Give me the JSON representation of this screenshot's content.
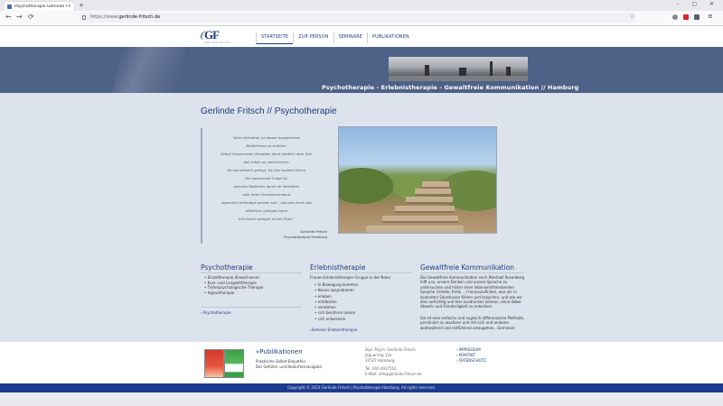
{
  "browser": {
    "tab_title": "Psychotherapie Gerlinde Fritsch",
    "tab_close": "×",
    "new_tab": "+",
    "url_scheme": "https://www.",
    "url_host": "gerlinde-fritsch.de",
    "back": "←",
    "forward": "→",
    "reload": "⟳"
  },
  "header": {
    "logo_text": "GF",
    "logo_sub": "GERLINDE FRITSCH",
    "nav": [
      "STARTSEITE",
      "ZUR PERSON",
      "SEMINARE",
      "PUBLIKATIONEN"
    ]
  },
  "banner": {
    "tagline": "Psychotherapie - Erlebnistherapie - Gewaltfreie Kommunikation // Hamburg"
  },
  "main": {
    "title": "Gerlinde Fritsch // Psychotherapie",
    "quote_lines": [
      "\"Alles Verhalten ist darauf ausgerichtet,",
      "Bedürfnisse zu erfüllen.",
      "Selbst tragischstes Verhalten dient letztlich dem Ziel,",
      "das Leben zu verschönern.",
      "Ob das wirklich gelingt, ist eine andere Sache.",
      "Die spannende Frage ist,",
      "welches Bedürfnis durch Ihr Verhalten",
      "oder Ihren Verhaltensimpuls",
      "eigentlich befriedigt werden soll – und wie Ihnen das",
      "effektiver gelingen kann",
      "mit einem weniger hohen Preis.\""
    ],
    "quote_author": "Gerlinde Fritsch",
    "quote_role": "Psychotherapie Hamburg"
  },
  "columns": {
    "psychotherapie": {
      "title": "Psychotherapie",
      "items": [
        "Einzeltherapie (Erwachsene)",
        "Kurz- und Langzeittherapie",
        "Tiefenpsychologische Therapie",
        "Hypnotherapie"
      ],
      "link": "› Psychotherapie"
    },
    "erlebnistherapie": {
      "title": "Erlebnistherapie",
      "intro": "Frauen-Erlebnistherapie-Gruppe in der Natur",
      "items": [
        "In Bewegung kommen",
        "Neues ausprobieren",
        "erleben",
        "entdecken",
        "verstehen",
        "sich berühren lassen",
        "sich entwickeln"
      ],
      "link": "›Seminar Erlebnistherapie"
    },
    "gfk": {
      "title": "Gewaltfreie Kommunikation",
      "para1": [
        "Die Gewaltfreie Kommunikation nach Marshall Rosenberg",
        "hilft uns, unsere Denken und unsere Sprache zu",
        "untersuchen und hinter einer lebensentfremdenden",
        "Sprache (Urteile, Kritik ...) herauszufinden, was wir in",
        "konkreten Situationen fühlen und brauchen, und wie wir",
        "dies aufrichtig und klar ausdrücken können, ohne dabei",
        "Abwehr und Feindseligkeit zu erwecken."
      ],
      "para2": [
        "Sie ist eine einfache und zugleich differenzierte Methode,",
        "persönlich zu wachsen und mit sich und anderen",
        "wohlwollend und mitfühlend umzugehen. ›Seminare"
      ]
    }
  },
  "footer": {
    "pub_title": "»Publikationen",
    "pub_lines": [
      "Praktische Selbst-Empathie",
      "Der Gefühls- und Bedürfnisnavigator"
    ],
    "address": [
      "Dipl. Psych. Gerlinde Fritsch",
      "Jaguarring 12a",
      "22527 Hamburg"
    ],
    "contact": [
      "Tel. 040.4917510",
      "E-Mail: info@gerlinde-fritsch.de"
    ],
    "links": [
      "› IMPRESSUM",
      "› KONTAKT",
      "› DATENSCHUTZ"
    ],
    "copyright": "Copyright © 2023 Gerlinde Fritsch | Psychotherapie Hamburg. All rights reserved."
  },
  "colors": {
    "brand_blue": "#1d3c7a",
    "banner": "#4e6186",
    "content_bg": "#dde3ec",
    "bottom_bar": "#1d3c8f"
  }
}
